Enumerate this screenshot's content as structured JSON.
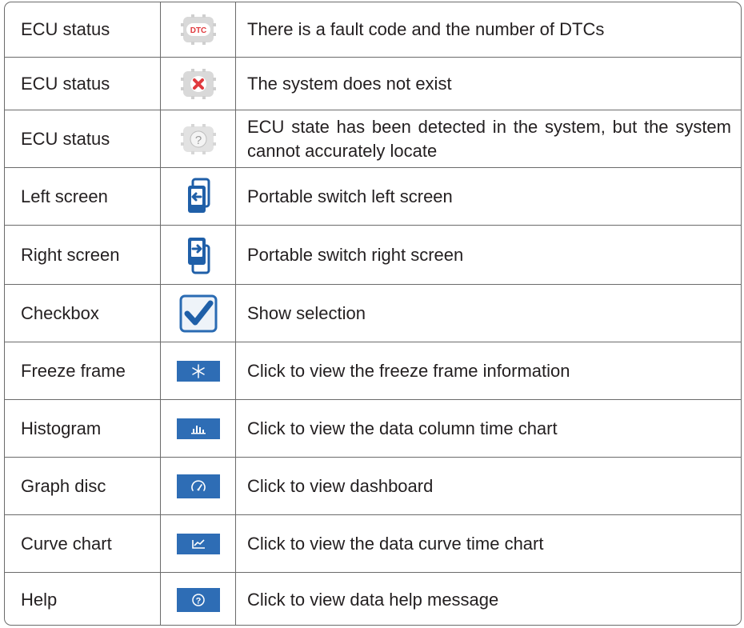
{
  "rows": [
    {
      "name": "ECU status",
      "icon": "dtc-fault-icon",
      "badge": "DTC",
      "description": "There is a fault code and the number of DTCs"
    },
    {
      "name": "ECU status",
      "icon": "system-not-exist-icon",
      "description": "The system does not exist"
    },
    {
      "name": "ECU status",
      "icon": "unknown-state-icon",
      "badge": "?",
      "description": "ECU state has been detected in the system, but the system cannot accurately locate"
    },
    {
      "name": "Left screen",
      "icon": "switch-left-screen-icon",
      "description": "Portable switch left screen"
    },
    {
      "name": "Right screen",
      "icon": "switch-right-screen-icon",
      "description": "Portable switch right screen"
    },
    {
      "name": "Checkbox",
      "icon": "checkbox-checked-icon",
      "description": "Show selection"
    },
    {
      "name": "Freeze frame",
      "icon": "freeze-frame-icon",
      "description": "Click to view the freeze frame information"
    },
    {
      "name": "Histogram",
      "icon": "histogram-icon",
      "description": "Click to view the data column time chart"
    },
    {
      "name": "Graph disc",
      "icon": "dashboard-gauge-icon",
      "description": "Click to view dashboard"
    },
    {
      "name": "Curve chart",
      "icon": "curve-chart-icon",
      "description": "Click to view the data curve time chart"
    },
    {
      "name": "Help",
      "icon": "help-icon",
      "badge": "?",
      "description": "Click to view data help message"
    }
  ],
  "colors": {
    "border": "#6b6b6b",
    "button_blue": "#2e6db5",
    "dtc_red": "#e03a3e",
    "chip_gray": "#d9d9d9"
  }
}
